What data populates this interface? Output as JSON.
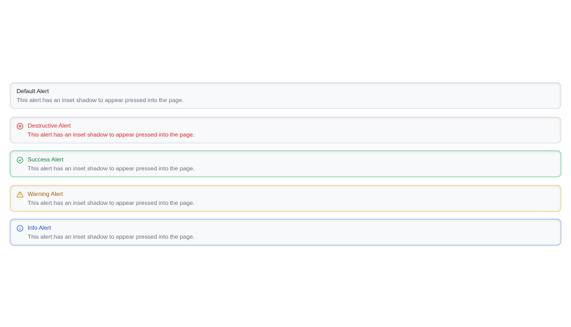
{
  "alerts": [
    {
      "variant": "default",
      "title": "Default Alert",
      "description": "This alert has an inset shadow to appear pressed into the page."
    },
    {
      "variant": "destructive",
      "icon": "x-circle-icon",
      "title": "Destructive Alert",
      "description": "This alert has an inset shadow to appear pressed into the page.",
      "color": "#dc2626"
    },
    {
      "variant": "success",
      "icon": "check-circle-icon",
      "title": "Success Alert",
      "description": "This alert has an inset shadow to appear pressed into the page.",
      "color": "#16a34a"
    },
    {
      "variant": "warning",
      "icon": "warning-triangle-icon",
      "title": "Warning Alert",
      "description": "This alert has an inset shadow to appear pressed into the page.",
      "color": "#ca8a04"
    },
    {
      "variant": "info",
      "icon": "info-circle-icon",
      "title": "Info Alert",
      "description": "This alert has an inset shadow to appear pressed into the page.",
      "color": "#2563eb"
    }
  ]
}
